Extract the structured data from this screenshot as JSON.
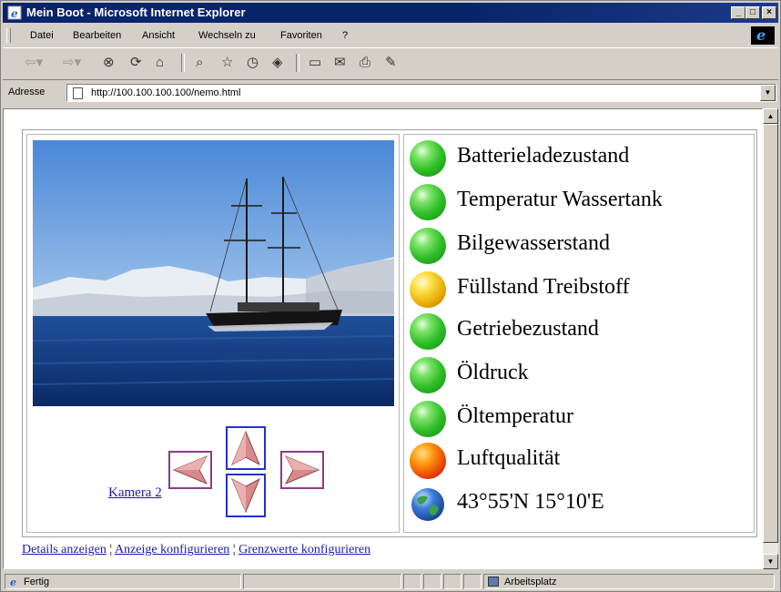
{
  "window": {
    "title": "Mein Boot - Microsoft Internet Explorer"
  },
  "menu": [
    "Datei",
    "Bearbeiten",
    "Ansicht",
    "Wechseln zu",
    "Favoriten",
    "?"
  ],
  "address": {
    "label": "Adresse",
    "url": "http://100.100.100.100/nemo.html"
  },
  "status_items": [
    {
      "label": "Batterieladezustand",
      "state": "green"
    },
    {
      "label": "Temperatur Wassertank",
      "state": "green"
    },
    {
      "label": "Bilgewasserstand",
      "state": "green"
    },
    {
      "label": "Füllstand Treibstoff",
      "state": "yellow"
    },
    {
      "label": "Getriebezustand",
      "state": "green"
    },
    {
      "label": "Öldruck",
      "state": "green"
    },
    {
      "label": "Öltemperatur",
      "state": "green"
    },
    {
      "label": "Luftqualität",
      "state": "red"
    },
    {
      "label": "43°55'N 15°10'E",
      "state": "globe"
    }
  ],
  "camera": {
    "link": "Kamera 2"
  },
  "footer_links": {
    "details": "Details anzeigen",
    "sep": "¦",
    "configure": "Anzeige konfigurieren",
    "limits": "Grenzwerte konfigurieren"
  },
  "statusbar": {
    "text": "Fertig",
    "zone": "Arbeitsplatz"
  },
  "colors": {
    "titlebar": "#0a246a",
    "link": "#1a1aa8",
    "ok": "#2fbf27",
    "warn": "#e6a800",
    "alarm": "#e83a00"
  }
}
